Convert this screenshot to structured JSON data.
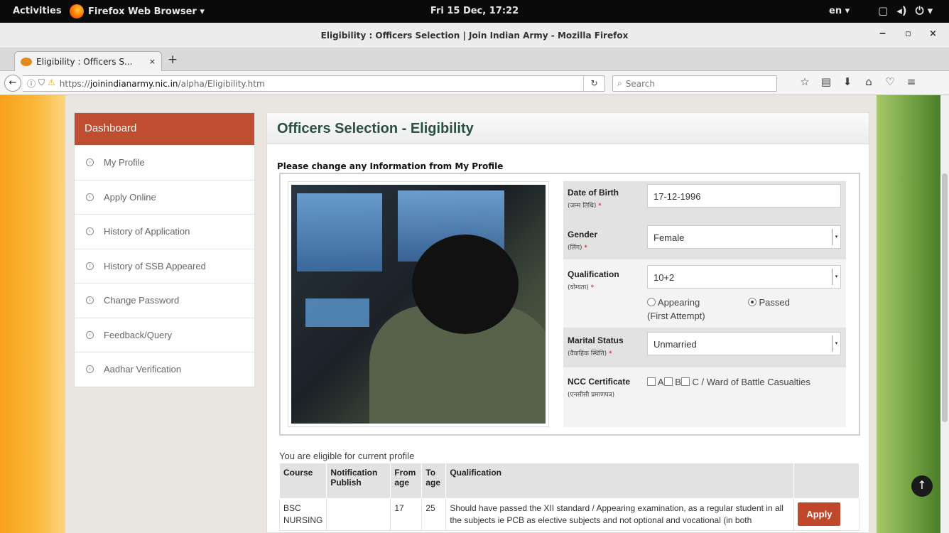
{
  "system_bar": {
    "activities": "Activities",
    "app_menu": "Firefox Web Browser ▾",
    "clock": "Fri 15 Dec, 17:22",
    "lang": "en ▾",
    "icons": [
      "window-icon",
      "volume-icon",
      "power-icon"
    ]
  },
  "window": {
    "title": "Eligibility : Officers Selection | Join Indian Army - Mozilla Firefox",
    "min": "‒",
    "max": "▫",
    "close": "×"
  },
  "tab": {
    "title": "Eligibility : Officers S...",
    "close": "×",
    "new_tab": "+"
  },
  "navbar": {
    "url_prefix": "https://",
    "url_host": "joinindianarmy.nic.in",
    "url_path": "/alpha/Eligibility.htm",
    "search_placeholder": "Search"
  },
  "sidebar": {
    "heading": "Dashboard",
    "items": [
      {
        "label": "My Profile"
      },
      {
        "label": "Apply Online"
      },
      {
        "label": "History of Application"
      },
      {
        "label": "History of SSB Appeared"
      },
      {
        "label": "Change Password"
      },
      {
        "label": "Feedback/Query"
      },
      {
        "label": "Aadhar Verification"
      }
    ]
  },
  "main": {
    "heading": "Officers Selection - Eligibility",
    "subtitle": "Please change any Information from My Profile",
    "form": {
      "dob": {
        "label": "Date of Birth",
        "hindi": "(जन्म तिथि)",
        "value": "17-12-1996"
      },
      "gender": {
        "label": "Gender",
        "hindi": "(लिंग)",
        "value": "Female"
      },
      "qualification": {
        "label": "Qualification",
        "hindi": "(योग्यता)",
        "value": "10+2",
        "option_appearing": "Appearing",
        "option_appearing_note": "(First Attempt)",
        "option_passed": "Passed",
        "selected": "Passed"
      },
      "marital": {
        "label": "Marital Status",
        "hindi": "(वैवाहिक स्थिति)",
        "value": "Unmarried"
      },
      "ncc": {
        "label": "NCC Certificate",
        "hindi": "(एनसीसी प्रमाणपत्र)",
        "options": [
          "A",
          "B",
          "C / Ward of Battle Casualties"
        ]
      }
    },
    "eligible_msg": "You are eligible for current profile",
    "table": {
      "headers": [
        "Course",
        "Notification Publish",
        "From age",
        "To age",
        "Qualification",
        ""
      ],
      "rows": [
        {
          "course": "BSC NURSING",
          "notification": "",
          "from_age": "17",
          "to_age": "25",
          "qualification": "Should have passed the XII standard / Appearing examination, as a regular student in all the subjects ie PCB as elective subjects and not optional and vocational (in both",
          "action": "Apply"
        }
      ]
    }
  },
  "colors": {
    "sidebar_head": "#bf4e30",
    "heading_text": "#2c4f44",
    "apply_button": "#c0472a"
  }
}
